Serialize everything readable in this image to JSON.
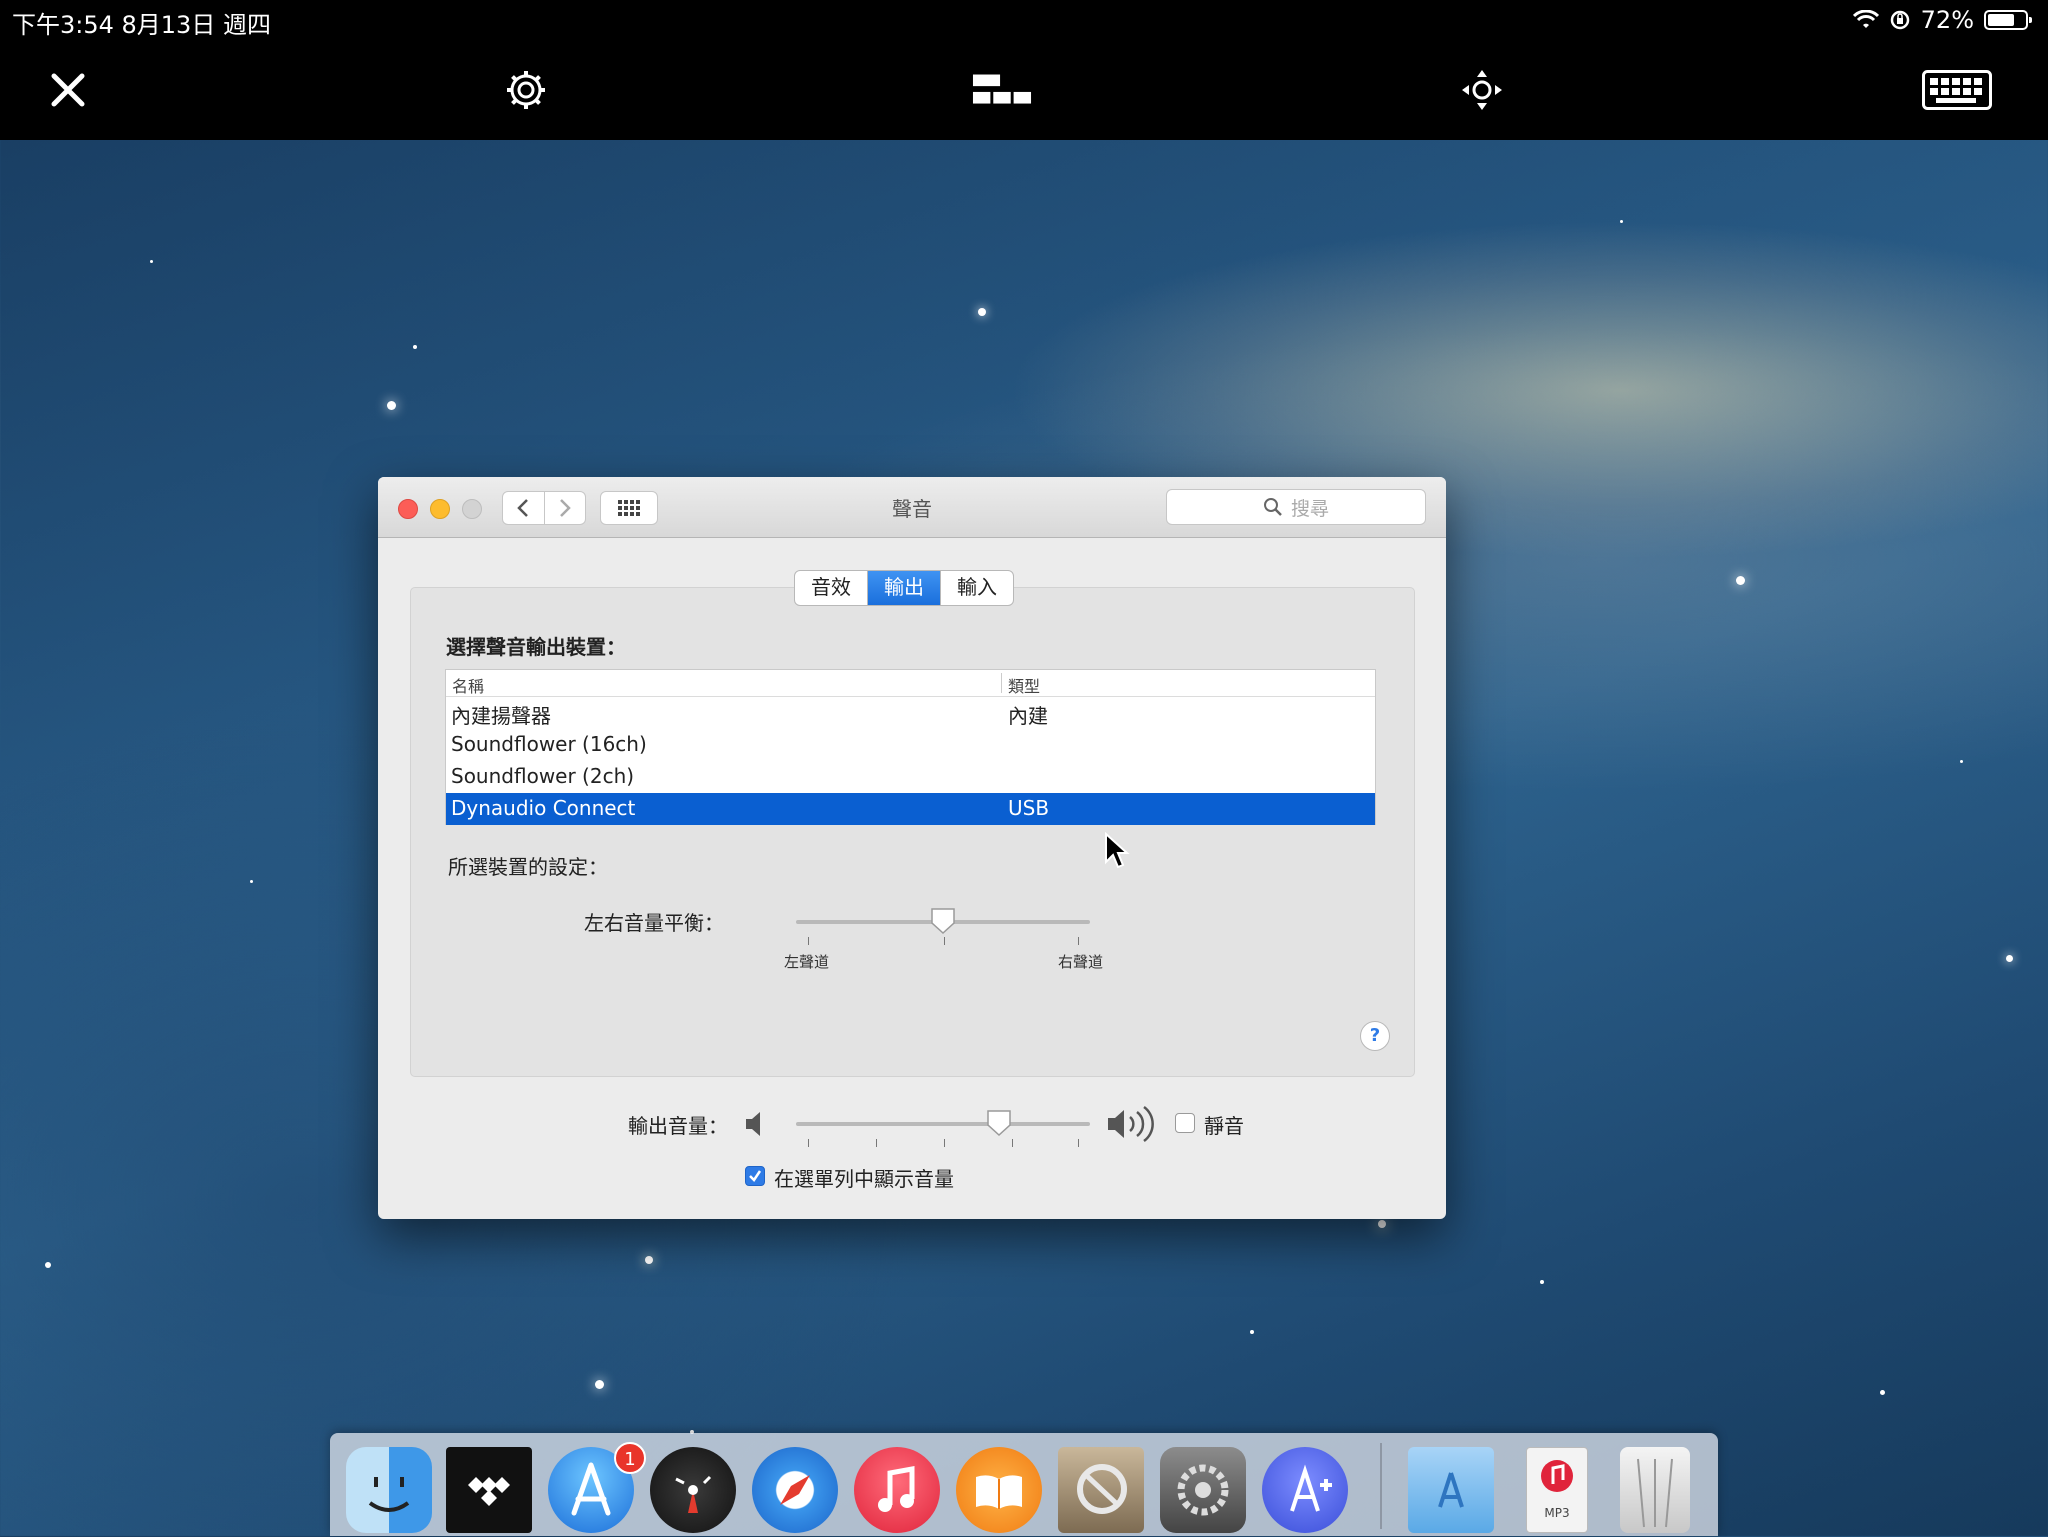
{
  "status_bar": {
    "time_date": "下午3:54   8月13日 週四",
    "battery_percent": "72%",
    "battery_level": 0.72
  },
  "toolbar": {
    "icons": [
      "close-icon",
      "gear-icon",
      "layout-icon",
      "move-icon",
      "keyboard-icon"
    ]
  },
  "window": {
    "title": "聲音",
    "search_placeholder": "搜尋",
    "tabs": [
      {
        "label": "音效",
        "active": false
      },
      {
        "label": "輸出",
        "active": true
      },
      {
        "label": "輸入",
        "active": false
      }
    ],
    "device_heading": "選擇聲音輸出裝置：",
    "table": {
      "headers": [
        "名稱",
        "類型"
      ],
      "rows": [
        {
          "name": "內建揚聲器",
          "type": "內建",
          "selected": false
        },
        {
          "name": "Soundflower (16ch)",
          "type": "",
          "selected": false
        },
        {
          "name": "Soundflower (2ch)",
          "type": "",
          "selected": false
        },
        {
          "name": "Dynaudio Connect",
          "type": "USB",
          "selected": true
        }
      ]
    },
    "settings_heading": "所選裝置的設定：",
    "balance": {
      "label": "左右音量平衡：",
      "left_label": "左聲道",
      "right_label": "右聲道",
      "value": 0.5
    },
    "help_label": "?",
    "output_volume": {
      "label": "輸出音量：",
      "value": 0.69,
      "mute_label": "靜音",
      "muted": false
    },
    "show_in_menubar": {
      "label": "在選單列中顯示音量",
      "checked": true
    }
  },
  "dock": {
    "items": [
      "Finder",
      "TIDAL",
      "App Store",
      "Dashboard",
      "Safari",
      "iTunes",
      "iBooks",
      "Preview",
      "System Preferences",
      "Instruments",
      "Applications",
      "MP3",
      "Trash"
    ],
    "app_store_badge": "1",
    "mp3_label": "MP3"
  },
  "colors": {
    "selection": "#0a5fd1",
    "accent": "#2e7be6",
    "close_light": "#fc5d57",
    "minimize_light": "#fdbc2e"
  }
}
